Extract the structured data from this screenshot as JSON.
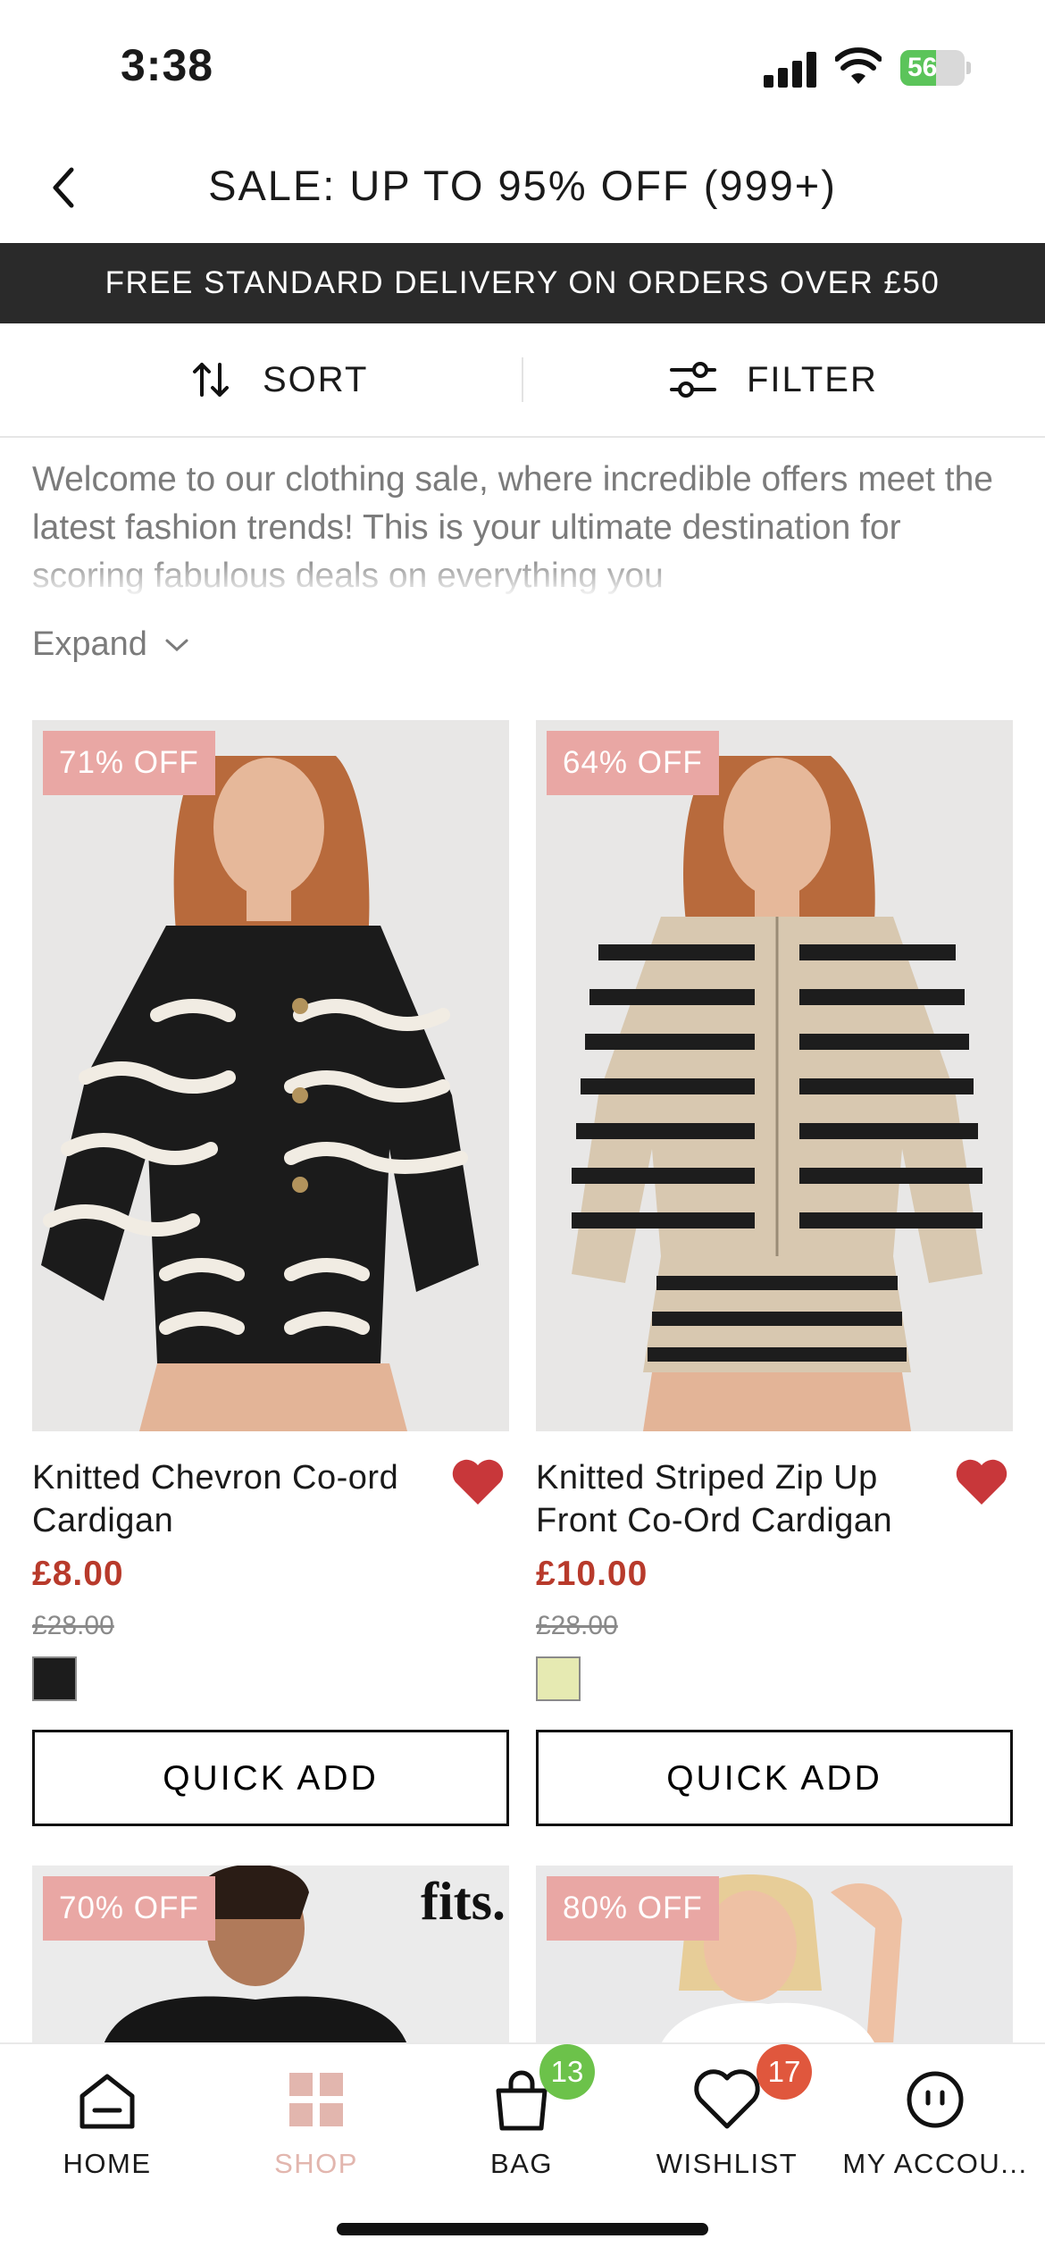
{
  "status_bar": {
    "time": "3:38",
    "battery": "56",
    "battery_level": 0.56
  },
  "header": {
    "title": "SALE: UP TO 95% OFF (999+)"
  },
  "banner": {
    "text": "FREE STANDARD DELIVERY ON ORDERS OVER £50"
  },
  "toolbar": {
    "sort_label": "SORT",
    "filter_label": "FILTER"
  },
  "intro": {
    "text": "Welcome to our clothing sale, where incredible offers meet the latest fashion trends! This is your ultimate destination for scoring fabulous deals on everything you",
    "expand_label": "Expand"
  },
  "products": [
    {
      "badge": "71% OFF",
      "name": "Knitted Chevron Co-ord Cardigan",
      "price": "£8.00",
      "was_price": "£28.00",
      "swatch_color": "#1c1c1c",
      "quick_add": "QUICK ADD"
    },
    {
      "badge": "64% OFF",
      "name": "Knitted Striped Zip Up Front Co-Ord Cardigan",
      "price": "£10.00",
      "was_price": "£28.00",
      "swatch_color": "#e6eab2",
      "quick_add": "QUICK ADD"
    },
    {
      "badge": "70% OFF",
      "logo": "fits."
    },
    {
      "badge": "80% OFF"
    }
  ],
  "bottom_nav": {
    "home": "HOME",
    "shop": "SHOP",
    "bag": "BAG",
    "bag_count": "13",
    "wishlist": "WISHLIST",
    "wishlist_count": "17",
    "account": "MY ACCOU..."
  },
  "colors": {
    "badge": "#e9a7a4",
    "price": "#b83a2b",
    "heart": "#c8373a",
    "active_nav": "#e2b6ae",
    "bag_badge": "#6cc24a",
    "wishlist_badge": "#e0573d"
  }
}
